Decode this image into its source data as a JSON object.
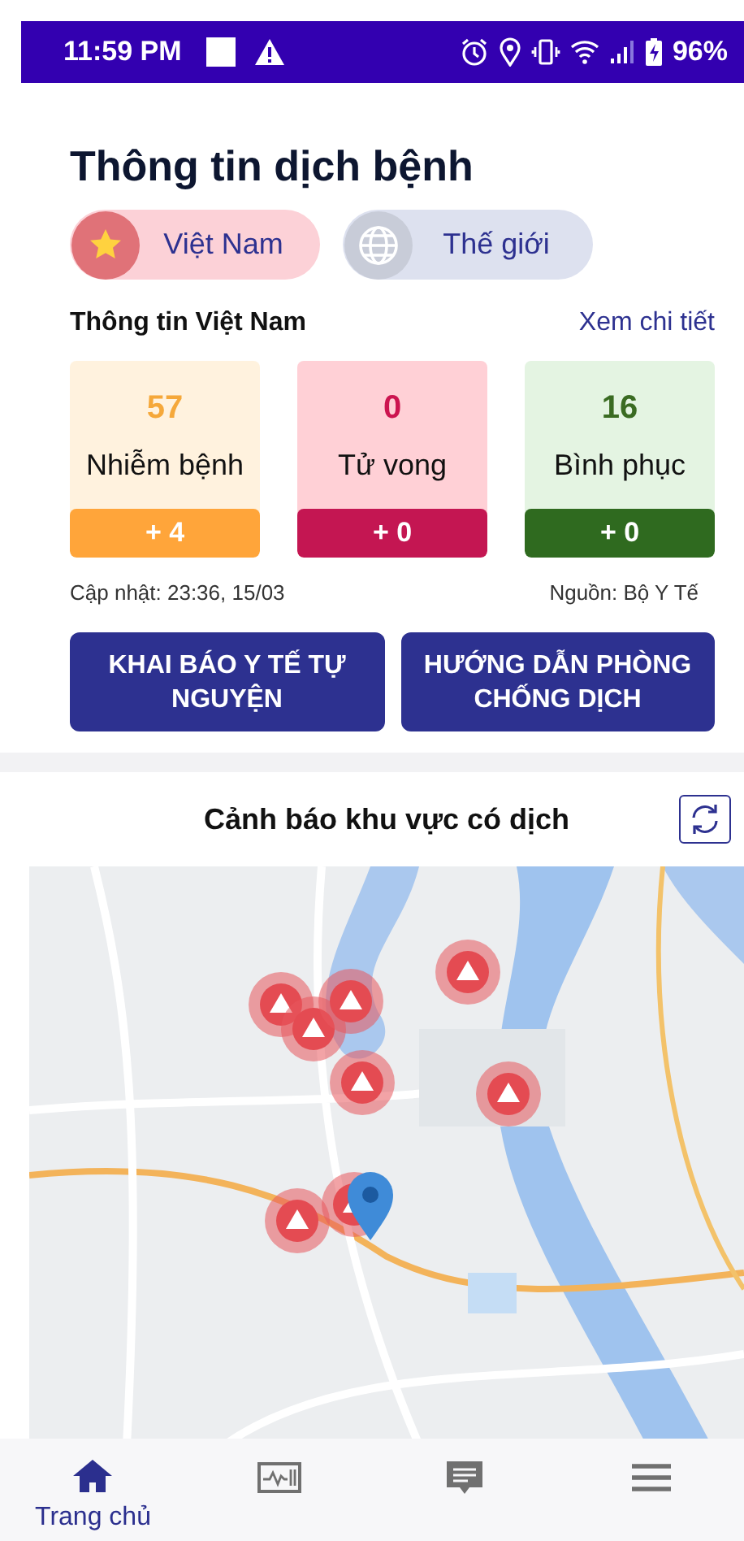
{
  "status_bar": {
    "time": "11:59 PM",
    "battery": "96%"
  },
  "title": "Thông tin dịch bệnh",
  "region_tabs": [
    {
      "label": "Việt Nam",
      "kind": "flag",
      "selected": true
    },
    {
      "label": "Thế giới",
      "kind": "globe",
      "selected": false
    }
  ],
  "section": {
    "title": "Thông tin Việt Nam",
    "link": "Xem chi tiết"
  },
  "stats": [
    {
      "kind": "infected",
      "value": "57",
      "label": "Nhiễm bệnh",
      "delta": "+ 4"
    },
    {
      "kind": "deaths",
      "value": "0",
      "label": "Tử vong",
      "delta": "+ 0"
    },
    {
      "kind": "recovered",
      "value": "16",
      "label": "Bình phục",
      "delta": "+ 0"
    }
  ],
  "updated": "Cập nhật: 23:36, 15/03",
  "source": "Nguồn: Bộ Y Tế",
  "action_buttons": [
    "KHAI BÁO Y TẾ TỰ NGUYỆN",
    "HƯỚNG DẪN PHÒNG CHỐNG DỊCH"
  ],
  "map_section": {
    "title": "Cảnh báo khu vực có dịch"
  },
  "bottom_nav": [
    {
      "kind": "home",
      "label": "Trang chủ",
      "selected": true
    },
    {
      "kind": "monitor",
      "selected": false
    },
    {
      "kind": "chat",
      "selected": false
    },
    {
      "kind": "menu",
      "selected": false
    }
  ]
}
